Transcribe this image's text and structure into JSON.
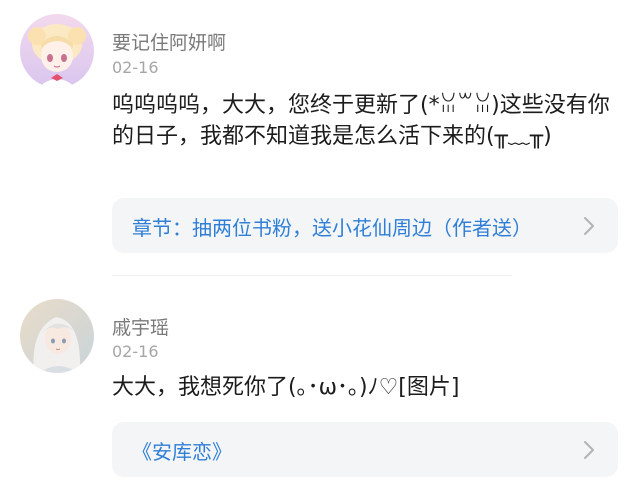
{
  "comments": [
    {
      "username": "要记住阿妍啊",
      "date": "02-16",
      "text": "呜呜呜呜，大大，您终于更新了(*ꈍ꒳ꈍ)这些没有你的日子，我都不知道我是怎么活下来的(╥﹏╥)",
      "link": "章节：抽两位书粉，送小花仙周边（作者送）",
      "avatar_icon": "anime-girl-avatar-icon"
    },
    {
      "username": "戚宇瑶",
      "date": "02-16",
      "text": "大大，我想死你了(｡･ω･｡)ﾉ♡[图片]",
      "link": "《安库恋》",
      "avatar_icon": "anime-white-hair-avatar-icon"
    }
  ],
  "colors": {
    "link": "#2f7fd6",
    "card_bg": "#f4f5f7",
    "username": "#7a7a7a",
    "date": "#a6a6a6",
    "text": "#1c1c1c"
  }
}
